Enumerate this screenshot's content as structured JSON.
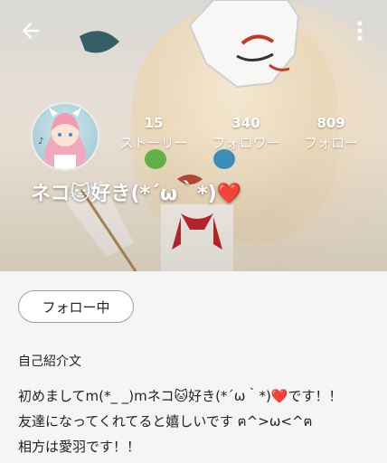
{
  "profile": {
    "username": "ネコ🐱好き(*´ω｀*)❤️",
    "stats": [
      {
        "value": "15",
        "label": "ストーリー"
      },
      {
        "value": "340",
        "label": "フォロワー"
      },
      {
        "value": "809",
        "label": "フォロー"
      }
    ],
    "follow_button": "フォロー中",
    "bio_title": "自己紹介文",
    "bio_lines": [
      "初めましてm(*_ _)mネコ🐱好き(*´ω｀*)❤️です！！",
      "友達になってくれてると嬉しいです ฅ^>ω<^ฅ",
      "相方は愛羽です！！"
    ]
  },
  "icons": {
    "back": "arrow-back-icon",
    "more": "more-vert-icon",
    "avatar": "avatar-image"
  },
  "colors": {
    "text": "#222222",
    "button_border": "#9e9e9e",
    "background": "#f5f5f5"
  }
}
